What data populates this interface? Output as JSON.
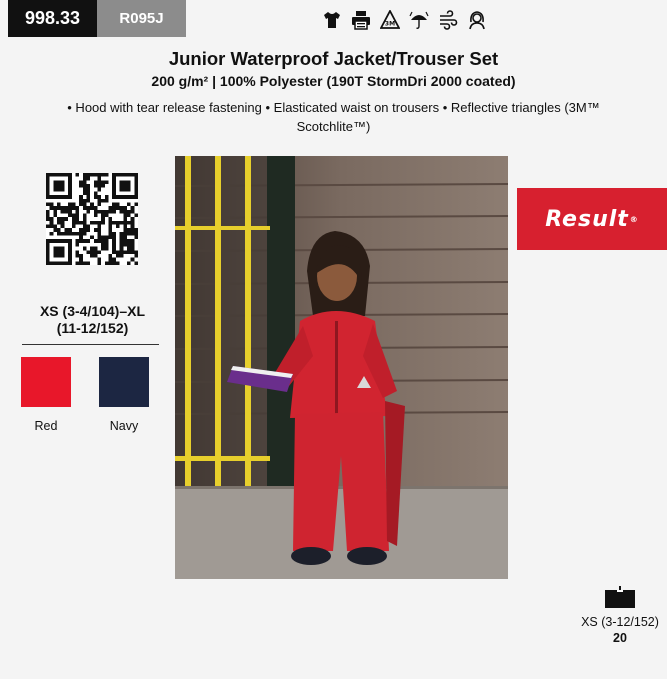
{
  "header": {
    "code": "998.33",
    "article": "R095J",
    "feature_icons": [
      "tshirt-icon",
      "print-icon",
      "reflective-3m-icon",
      "waterproof-icon",
      "windproof-icon",
      "hood-icon"
    ],
    "icon_badge": "3M"
  },
  "product": {
    "title": "Junior Waterproof Jacket/Trouser Set",
    "subtitle": "200 g/m² | 100% Polyester (190T StormDri 2000 coated)",
    "features": "• Hood with tear release fastening • Elasticated waist on trousers • Reflective triangles (3M™ Scotchlite™)"
  },
  "sizes": {
    "line1": "XS (3-4/104)–XL",
    "line2": "(11-12/152)"
  },
  "colors": [
    {
      "name": "Red",
      "hex": "#e8172a"
    },
    {
      "name": "Navy",
      "hex": "#1c2642"
    }
  ],
  "brand": {
    "name": "Result",
    "mark": "®",
    "color": "#d7202f"
  },
  "pack": {
    "size": "XS (3-12/152)",
    "quantity": "20"
  }
}
